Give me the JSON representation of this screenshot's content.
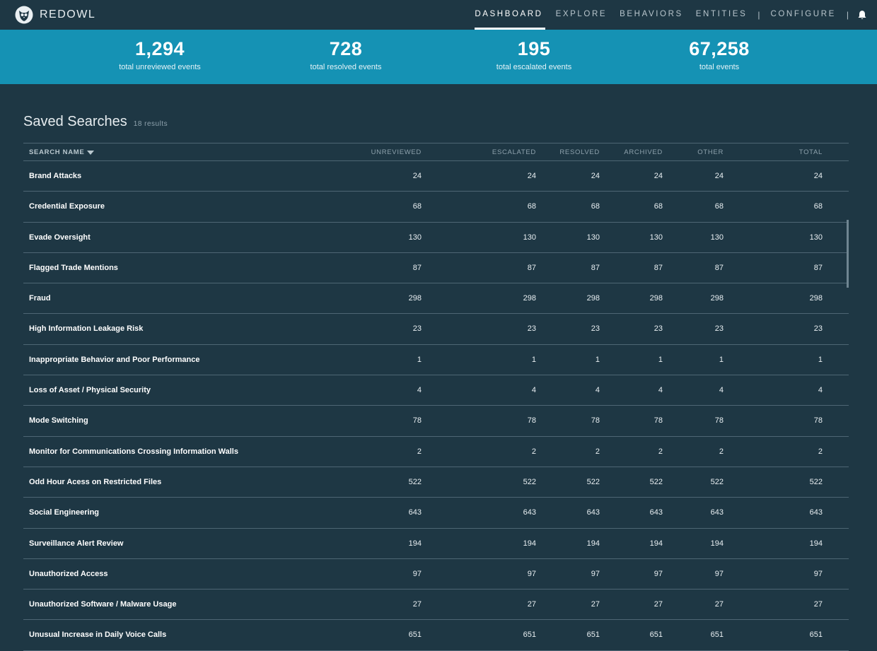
{
  "brand": {
    "name": "REDOWL"
  },
  "nav": {
    "items": [
      "DASHBOARD",
      "EXPLORE",
      "BEHAVIORS",
      "ENTITIES"
    ],
    "separator": "|",
    "configure": "CONFIGURE",
    "active": "DASHBOARD"
  },
  "stats": [
    {
      "value": "1,294",
      "label": "total unreviewed events"
    },
    {
      "value": "728",
      "label": "total resolved events"
    },
    {
      "value": "195",
      "label": "total escalated events"
    },
    {
      "value": "67,258",
      "label": "total events"
    }
  ],
  "saved_searches": {
    "title": "Saved Searches",
    "count": "18 results",
    "columns": {
      "name": "SEARCH NAME",
      "unreviewed": "UNREVIEWED",
      "escalated": "ESCALATED",
      "resolved": "RESOLVED",
      "archived": "ARCHIVED",
      "other": "OTHER",
      "total": "TOTAL"
    },
    "rows": [
      {
        "name": "Brand Attacks",
        "unreviewed": "24",
        "escalated": "24",
        "resolved": "24",
        "archived": "24",
        "other": "24",
        "total": "24"
      },
      {
        "name": "Credential Exposure",
        "unreviewed": "68",
        "escalated": "68",
        "resolved": "68",
        "archived": "68",
        "other": "68",
        "total": "68"
      },
      {
        "name": "Evade Oversight",
        "unreviewed": "130",
        "escalated": "130",
        "resolved": "130",
        "archived": "130",
        "other": "130",
        "total": "130"
      },
      {
        "name": "Flagged Trade Mentions",
        "unreviewed": "87",
        "escalated": "87",
        "resolved": "87",
        "archived": "87",
        "other": "87",
        "total": "87"
      },
      {
        "name": "Fraud",
        "unreviewed": "298",
        "escalated": "298",
        "resolved": "298",
        "archived": "298",
        "other": "298",
        "total": "298"
      },
      {
        "name": "High Information Leakage Risk",
        "unreviewed": "23",
        "escalated": "23",
        "resolved": "23",
        "archived": "23",
        "other": "23",
        "total": "23"
      },
      {
        "name": "Inappropriate Behavior and Poor Performance",
        "unreviewed": "1",
        "escalated": "1",
        "resolved": "1",
        "archived": "1",
        "other": "1",
        "total": "1"
      },
      {
        "name": "Loss of Asset / Physical Security",
        "unreviewed": "4",
        "escalated": "4",
        "resolved": "4",
        "archived": "4",
        "other": "4",
        "total": "4"
      },
      {
        "name": "Mode Switching",
        "unreviewed": "78",
        "escalated": "78",
        "resolved": "78",
        "archived": "78",
        "other": "78",
        "total": "78"
      },
      {
        "name": "Monitor for Communications Crossing Information Walls",
        "unreviewed": "2",
        "escalated": "2",
        "resolved": "2",
        "archived": "2",
        "other": "2",
        "total": "2"
      },
      {
        "name": "Odd Hour Acess on Restricted Files",
        "unreviewed": "522",
        "escalated": "522",
        "resolved": "522",
        "archived": "522",
        "other": "522",
        "total": "522"
      },
      {
        "name": "Social Engineering",
        "unreviewed": "643",
        "escalated": "643",
        "resolved": "643",
        "archived": "643",
        "other": "643",
        "total": "643"
      },
      {
        "name": "Surveillance Alert Review",
        "unreviewed": "194",
        "escalated": "194",
        "resolved": "194",
        "archived": "194",
        "other": "194",
        "total": "194"
      },
      {
        "name": "Unauthorized Access",
        "unreviewed": "97",
        "escalated": "97",
        "resolved": "97",
        "archived": "97",
        "other": "97",
        "total": "97"
      },
      {
        "name": "Unauthorized Software / Malware Usage",
        "unreviewed": "27",
        "escalated": "27",
        "resolved": "27",
        "archived": "27",
        "other": "27",
        "total": "27"
      },
      {
        "name": "Unusual Increase in Daily Voice Calls",
        "unreviewed": "651",
        "escalated": "651",
        "resolved": "651",
        "archived": "651",
        "other": "651",
        "total": "651"
      }
    ]
  },
  "colors": {
    "background": "#1e3744",
    "stats_bar": "#1592b4",
    "divider": "#4e6674"
  },
  "icons": {
    "logo": "owl-logo-icon",
    "bell": "bell-icon",
    "sort": "caret-down-icon"
  }
}
